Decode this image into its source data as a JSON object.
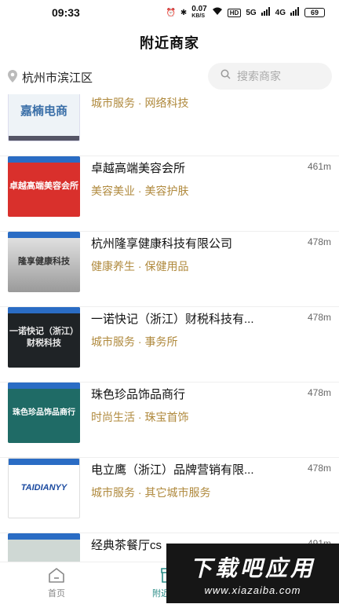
{
  "status_bar": {
    "time": "09:33",
    "net_speed": "0.07",
    "net_unit": "KB/S",
    "hd": "HD",
    "signal_a": "5G",
    "signal_b": "4G",
    "battery": "69"
  },
  "header": {
    "title": "附近商家"
  },
  "location": {
    "city": "杭州市滨江区"
  },
  "search": {
    "placeholder": "搜索商家"
  },
  "items": [
    {
      "name": "",
      "distance": "",
      "tags": "城市服务 · 网络科技",
      "thumb_text": "嘉楠电商"
    },
    {
      "name": "卓越高端美容会所",
      "distance": "461m",
      "tags": "美容美业 · 美容护肤",
      "thumb_text": "卓越高端美容会所"
    },
    {
      "name": "杭州隆享健康科技有限公司",
      "distance": "478m",
      "tags": "健康养生 · 保健用品",
      "thumb_text": "隆享健康科技"
    },
    {
      "name": "一诺快记（浙江）财税科技有...",
      "distance": "478m",
      "tags": "城市服务 · 事务所",
      "thumb_text": "一诺快记（浙江）财税科技"
    },
    {
      "name": "珠色珍品饰品商行",
      "distance": "478m",
      "tags": "时尚生活 · 珠宝首饰",
      "thumb_text": "珠色珍品饰品商行"
    },
    {
      "name": "电立鹰（浙江）品牌营销有限...",
      "distance": "478m",
      "tags": "城市服务 · 其它城市服务",
      "thumb_text": "TAIDIANYY"
    },
    {
      "name": "经典茶餐厅cs",
      "distance": "491m",
      "tags": "",
      "thumb_text": ""
    }
  ],
  "nav": {
    "home": "首页",
    "nearby": "附近商家"
  },
  "watermark": {
    "main": "下载吧应用",
    "sub": "www.xiazaiba.com"
  },
  "colors": {
    "accent": "#2a8c86",
    "tag": "#b08a3e"
  }
}
